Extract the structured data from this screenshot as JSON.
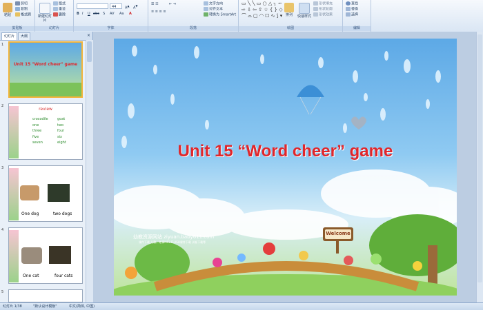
{
  "ribbon": {
    "clipboard": {
      "paste": "粘贴",
      "cut": "剪切",
      "copy": "复制",
      "format_painter": "格式刷",
      "label": "剪贴板"
    },
    "slides": {
      "new_slide": "新建幻灯片",
      "layout": "版式",
      "reset": "重设",
      "delete": "删除",
      "label": "幻灯片"
    },
    "font": {
      "name": "",
      "size": "44",
      "label": "字体"
    },
    "paragraph": {
      "text_direction": "文字方向",
      "align_text": "对齐文本",
      "smartart": "转换为 SmartArt",
      "label": "段落"
    },
    "drawing": {
      "arrange": "排列",
      "quick_styles": "快速样式",
      "shape_fill": "形状填充",
      "shape_outline": "形状轮廓",
      "shape_effects": "形状效果",
      "label": "绘图"
    },
    "editing": {
      "find": "查找",
      "replace": "替换",
      "select": "选择",
      "label": "编辑"
    }
  },
  "panel": {
    "tabs": [
      "幻灯片",
      "大纲"
    ],
    "close": "×",
    "thumbnails": [
      {
        "num": "1",
        "title": "Unit 15 \"Word cheer\" game"
      },
      {
        "num": "2",
        "heading": "review",
        "words_left": [
          "crocodile",
          "one",
          "three",
          "five",
          "seven"
        ],
        "words_right": [
          "goat",
          "two",
          "four",
          "six",
          "eight"
        ]
      },
      {
        "num": "3",
        "captions": [
          "One dog",
          "two dogs"
        ]
      },
      {
        "num": "4",
        "captions": [
          "One cat",
          "four cats"
        ]
      },
      {
        "num": "5"
      }
    ]
  },
  "slide": {
    "title": "Unit 15  “Word cheer” game",
    "watermark": "幼教资源网站  ziyuan.baby611.com",
    "watermark_sub": "课件下载   儿歌、故事MP3   FLASH课件下载   试卷下载等",
    "sign": "Welcome"
  },
  "status": {
    "slide_info": "幻灯片 1/38",
    "theme": "\"默认设计模板\"",
    "language": "中文(简体, 中国)"
  },
  "colors": {
    "title_red": "#e0262b",
    "ribbon_bg": "#dae6f4",
    "selection": "#f3b43a"
  }
}
